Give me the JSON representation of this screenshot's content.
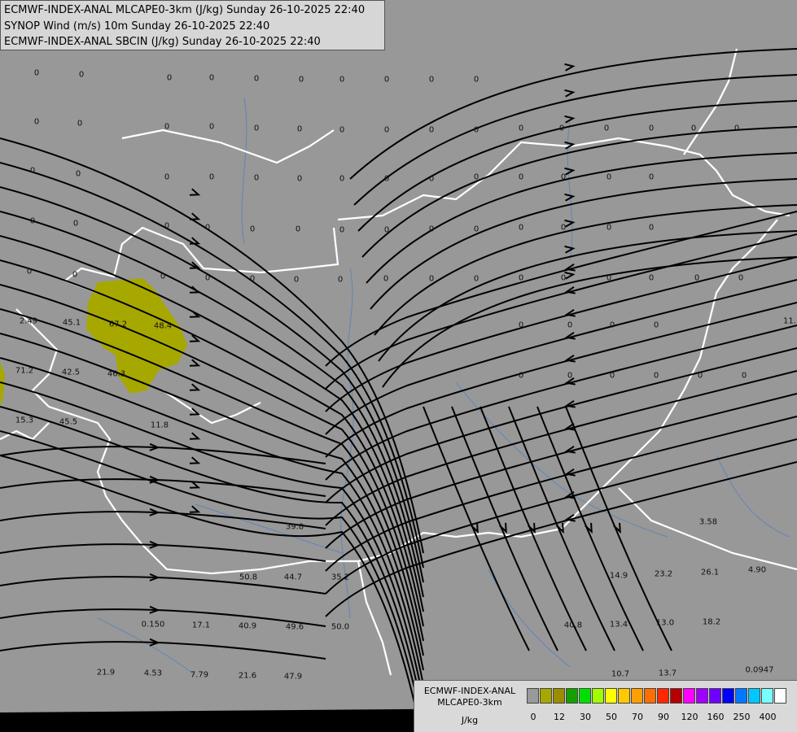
{
  "header": {
    "line1": "ECMWF-INDEX-ANAL MLCAPE0-3km (J/kg) Sunday 26-10-2025 22:40",
    "line2": "SYNOP Wind (m/s) 10m Sunday 26-10-2025 22:40",
    "line3": "ECMWF-INDEX-ANAL SBCIN (J/kg) Sunday 26-10-2025 22:40"
  },
  "colors": {
    "background": "#989898",
    "border": "#ffffff",
    "river": "#5e86b8",
    "streamline": "#000000",
    "cape_fill": "#a6a800"
  },
  "values": [
    {
      "t": "0"
    },
    {
      "t": "0"
    },
    {
      "t": "0"
    },
    {
      "t": "0"
    },
    {
      "t": "0"
    },
    {
      "t": "0"
    },
    {
      "t": "0"
    },
    {
      "t": "0"
    },
    {
      "t": "0"
    },
    {
      "t": "0"
    },
    {
      "t": "0"
    },
    {
      "t": "0"
    },
    {
      "t": "0"
    },
    {
      "t": "0"
    },
    {
      "t": "0"
    },
    {
      "t": "0"
    },
    {
      "t": "0"
    },
    {
      "t": "0"
    },
    {
      "t": "0"
    },
    {
      "t": "0"
    },
    {
      "t": "0"
    },
    {
      "t": "0"
    },
    {
      "t": "0"
    },
    {
      "t": "0"
    },
    {
      "t": "0"
    },
    {
      "t": "0"
    },
    {
      "t": "0"
    },
    {
      "t": "0"
    },
    {
      "t": "0"
    },
    {
      "t": "0"
    },
    {
      "t": "0"
    },
    {
      "t": "0"
    },
    {
      "t": "0"
    },
    {
      "t": "0"
    },
    {
      "t": "0"
    },
    {
      "t": "0"
    },
    {
      "t": "0"
    },
    {
      "t": "0"
    },
    {
      "t": "0"
    },
    {
      "t": "0"
    },
    {
      "t": "0"
    },
    {
      "t": "0"
    },
    {
      "t": "0"
    },
    {
      "t": "0"
    },
    {
      "t": "0"
    },
    {
      "t": "0"
    },
    {
      "t": "0"
    },
    {
      "t": "0"
    },
    {
      "t": "0"
    },
    {
      "t": "0"
    },
    {
      "t": "0"
    },
    {
      "t": "0"
    },
    {
      "t": "0"
    },
    {
      "t": "0"
    },
    {
      "t": "0"
    },
    {
      "t": "0"
    },
    {
      "t": "0"
    },
    {
      "t": "0"
    },
    {
      "t": "0"
    },
    {
      "t": "0"
    },
    {
      "t": "0"
    },
    {
      "t": "0"
    },
    {
      "t": "0"
    },
    {
      "t": "0"
    },
    {
      "t": "0"
    },
    {
      "t": "0"
    },
    {
      "t": "0"
    },
    {
      "t": "0"
    },
    {
      "t": "0"
    },
    {
      "t": "0"
    },
    {
      "t": "0"
    },
    {
      "t": "0"
    },
    {
      "t": "0"
    },
    {
      "t": "0"
    },
    {
      "t": "0"
    },
    {
      "t": "0"
    },
    {
      "t": "0"
    },
    {
      "t": "0"
    },
    {
      "t": "0"
    },
    {
      "t": "0"
    },
    {
      "t": "2.49"
    },
    {
      "t": "45.1"
    },
    {
      "t": "67.2"
    },
    {
      "t": "48.4"
    },
    {
      "t": "71.2"
    },
    {
      "t": "42.5"
    },
    {
      "t": "46.3"
    },
    {
      "t": "15.3"
    },
    {
      "t": "45.5"
    },
    {
      "t": "11.8"
    },
    {
      "t": "11."
    },
    {
      "t": "3.58"
    },
    {
      "t": "39.8"
    },
    {
      "t": "50.8"
    },
    {
      "t": "44.7"
    },
    {
      "t": "35.2"
    },
    {
      "t": "14.9"
    },
    {
      "t": "23.2"
    },
    {
      "t": "26.1"
    },
    {
      "t": "4.90"
    },
    {
      "t": "0.150"
    },
    {
      "t": "17.1"
    },
    {
      "t": "40.9"
    },
    {
      "t": "49.6"
    },
    {
      "t": "50.0"
    },
    {
      "t": "40.8"
    },
    {
      "t": "13.4"
    },
    {
      "t": "13.0"
    },
    {
      "t": "18.2"
    },
    {
      "t": "21.9"
    },
    {
      "t": "4.53"
    },
    {
      "t": "7.79"
    },
    {
      "t": "21.6"
    },
    {
      "t": "47.9"
    },
    {
      "t": "10.7"
    },
    {
      "t": "13.7"
    },
    {
      "t": "0.0947"
    }
  ],
  "legend": {
    "title_line1": "ECMWF-INDEX-ANAL",
    "title_line2": "MLCAPE0-3km",
    "unit": "J/kg",
    "colors": [
      "#9a9a9a",
      "#a6a800",
      "#9c8c00",
      "#14a000",
      "#00e000",
      "#a0ff00",
      "#ffff00",
      "#ffc800",
      "#ffa000",
      "#ff6e00",
      "#ff2800",
      "#b40000",
      "#ff00ff",
      "#a000ff",
      "#6e00ff",
      "#0000ff",
      "#0078ff",
      "#00c8ff",
      "#78ffff",
      "#ffffff"
    ],
    "ticks": [
      "0",
      "12",
      "30",
      "50",
      "70",
      "90",
      "120",
      "160",
      "250",
      "400"
    ]
  }
}
